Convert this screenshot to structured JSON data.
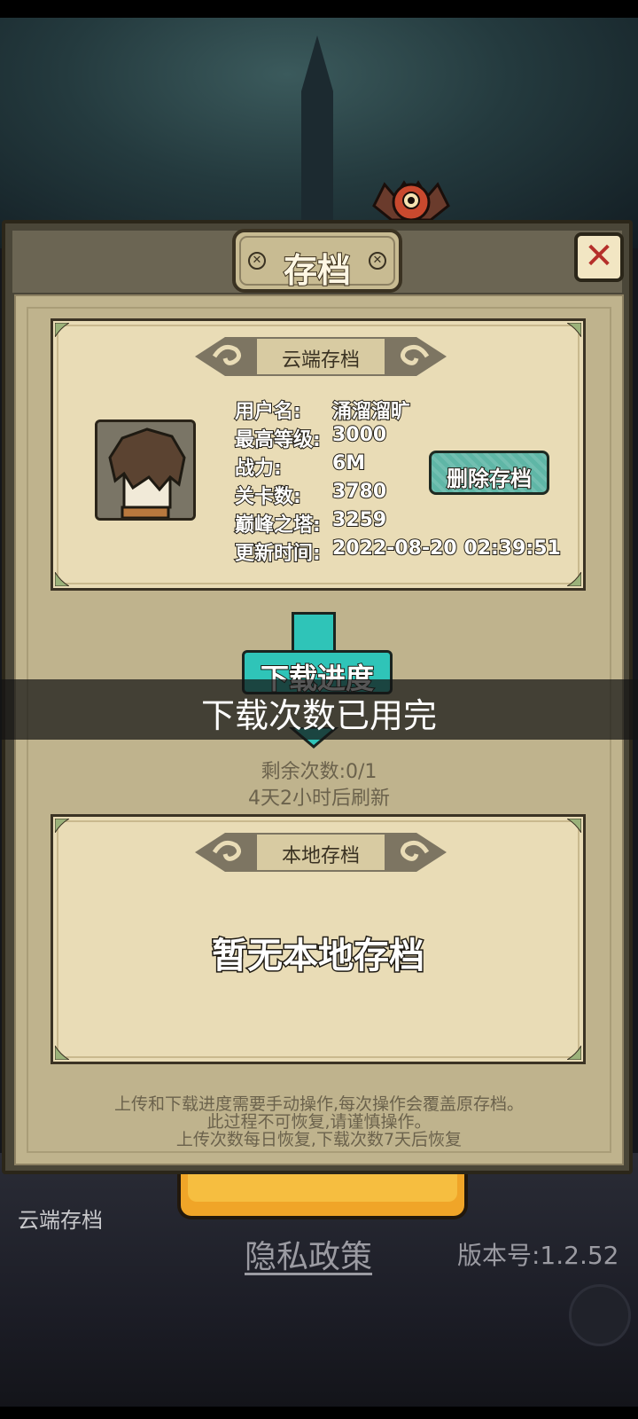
{
  "dialog": {
    "title": "存档",
    "close_label": "✕"
  },
  "cloud_save": {
    "ribbon": "云端存档",
    "fields": [
      {
        "label": "用户名:",
        "value": "涌溜溜旷"
      },
      {
        "label": "最高等级:",
        "value": "3000"
      },
      {
        "label": "战力:",
        "value": "6M"
      },
      {
        "label": "关卡数:",
        "value": "3780"
      },
      {
        "label": "巅峰之塔:",
        "value": "3259"
      },
      {
        "label": "更新时间:",
        "value": "2022-08-20 02:39:51"
      }
    ],
    "delete_button": "删除存档"
  },
  "download": {
    "button_label": "下载进度",
    "remaining": "剩余次数:0/1",
    "refresh": "4天2小时后刷新"
  },
  "toast": "下载次数已用完",
  "local_save": {
    "ribbon": "本地存档",
    "empty": "暂无本地存档"
  },
  "notice": [
    "上传和下载进度需要手动操作,每次操作会覆盖原存档。",
    "此过程不可恢复,请谨慎操作。",
    "上传次数每日恢复,下载次数7天后恢复"
  ],
  "background": {
    "cloud_save_label": "云端存档",
    "privacy_link": "隐私政策",
    "version": "版本号:1.2.52"
  },
  "colors": {
    "accent_teal": "#2fc4b8",
    "close_red": "#b52f2a",
    "parchment": "#e9dcb6"
  }
}
